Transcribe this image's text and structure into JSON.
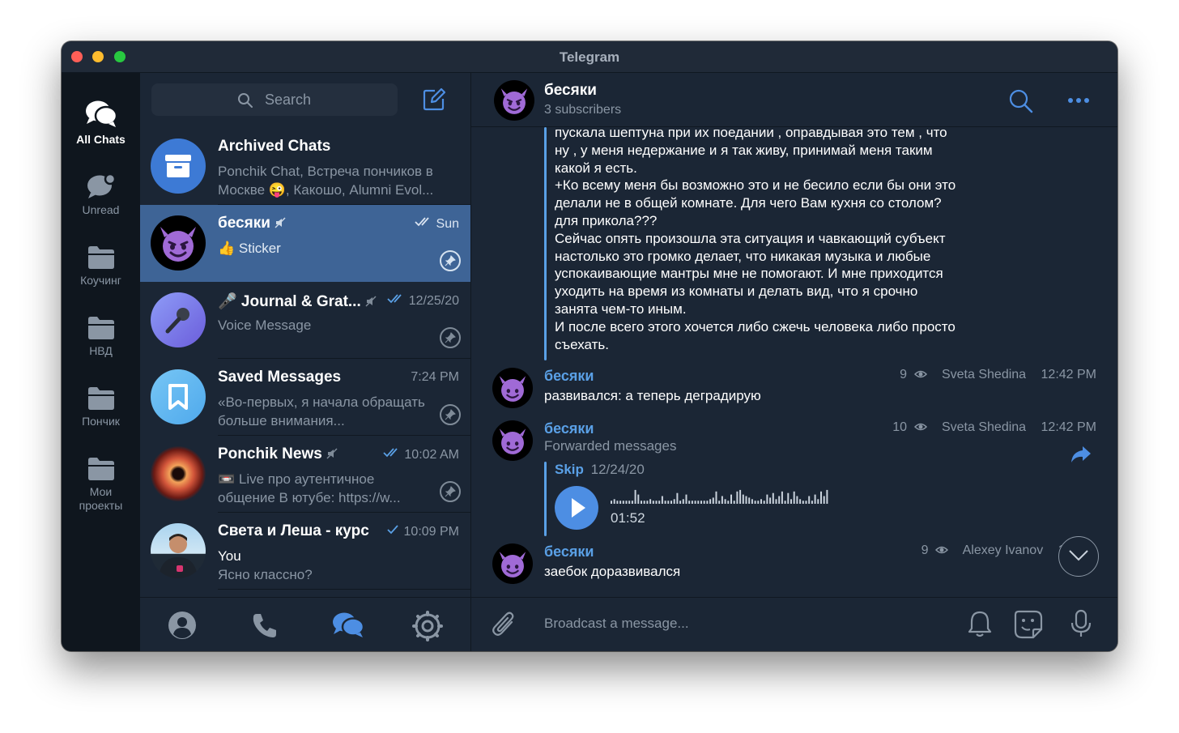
{
  "window": {
    "title": "Telegram"
  },
  "folders": [
    {
      "label": "All Chats",
      "icon": "chats-icon",
      "active": true
    },
    {
      "label": "Unread",
      "icon": "unread-chat-icon"
    },
    {
      "label": "Коучинг",
      "icon": "folder-icon"
    },
    {
      "label": "НВД",
      "icon": "folder-icon"
    },
    {
      "label": "Пончик",
      "icon": "folder-icon"
    },
    {
      "label": "Мои проекты",
      "icon": "folder-icon"
    }
  ],
  "search": {
    "placeholder": "Search"
  },
  "chats": [
    {
      "name": "Archived Chats",
      "time": "",
      "preview": "Ponchik Chat, Встреча пончиков в Москве 😜, Какошо, Alumni Evol...",
      "avatar": "archive"
    },
    {
      "name": "бесяки",
      "muted": true,
      "time": "Sun",
      "check": "double",
      "preview": "👍 Sticker",
      "pinned": true,
      "active": true,
      "avatar": "devil"
    },
    {
      "name": "🎤 Journal & Grat...",
      "muted": true,
      "time": "12/25/20",
      "check": "double",
      "preview": "Voice Message",
      "pinned": true,
      "avatar": "mic"
    },
    {
      "name": "Saved Messages",
      "time": "7:24 PM",
      "preview": "«Во-первых, я начала обращать больше внимания...",
      "pinned": true,
      "avatar": "bookmark"
    },
    {
      "name": "Ponchik News",
      "muted": true,
      "time": "10:02 AM",
      "check": "double",
      "preview": "📼 Live про аутентичное общение  В ютубе: https://w...",
      "pinned": true,
      "avatar": "donut"
    },
    {
      "name": "Света и Леша - курс",
      "time": "10:09 PM",
      "check": "single",
      "preview_sender": "You",
      "preview": "Ясно классно?",
      "avatar": "person"
    }
  ],
  "bottom_nav": [
    {
      "name": "contacts-icon"
    },
    {
      "name": "calls-icon"
    },
    {
      "name": "chats-icon",
      "active": true
    },
    {
      "name": "settings-icon"
    }
  ],
  "header": {
    "title": "бесяки",
    "subtitle": "3 subscribers"
  },
  "long_message": "пускала шептуна при их поедании , оправдывая это тем , что\nну , у меня недержание и я так живу, принимай меня таким\nкакой я есть.\n+Ко всему меня бы возможно это и не бесило если бы они это\nделали не в общей комнате. Для чего Вам кухня со столом?\nдля прикола???\nСейчас опять произошла эта ситуация и чавкающий субъект\nнастолько это громко делает, что никакая музыка и любые\nуспокаивающие мантры мне не помогают.  И мне приходится\nуходить на время из комнаты и делать вид, что я срочно\nзанята чем-то иным.\nИ после всего этого хочется либо сжечь человека либо просто\nсъехать.",
  "messages": [
    {
      "author": "бесяки",
      "text": "развивался: а теперь деградирую",
      "views": "9",
      "signer": "Sveta Shedina",
      "time": "12:42 PM"
    },
    {
      "author": "бесяки",
      "subtitle": "Forwarded messages",
      "views": "10",
      "signer": "Sveta Shedina",
      "time": "12:42 PM",
      "forward_from": "Skip",
      "forward_date": "12/24/20",
      "voice_duration": "01:52"
    },
    {
      "author": "бесяки",
      "text": "заебок доразвивался",
      "views": "9",
      "signer": "Alexey Ivanov",
      "time": "1:"
    }
  ],
  "composer": {
    "placeholder": "Broadcast a message..."
  },
  "colors": {
    "accent": "#5aa0e6",
    "selected": "#3e6496",
    "background": "#1b2635"
  }
}
